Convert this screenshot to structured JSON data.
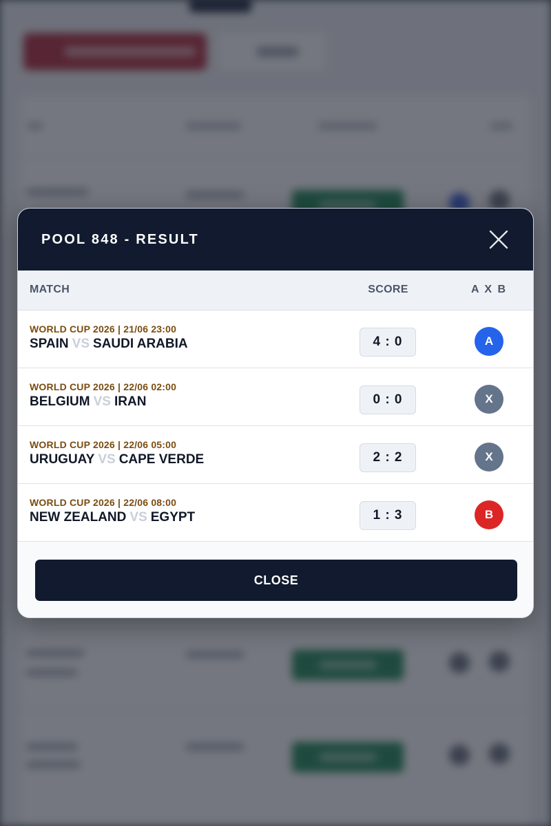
{
  "modal": {
    "title": "POOL 848 - RESULT",
    "close_button_label": "CLOSE",
    "columns": {
      "match": "MATCH",
      "score": "SCORE",
      "axb": "A X B"
    },
    "matches": [
      {
        "meta": "WORLD CUP 2026 | 21/06 23:00",
        "home": "SPAIN",
        "vs": "VS",
        "away": "SAUDI ARABIA",
        "score": "4 : 0",
        "result": "A"
      },
      {
        "meta": "WORLD CUP 2026 | 22/06 02:00",
        "home": "BELGIUM",
        "vs": "VS",
        "away": "IRAN",
        "score": "0 : 0",
        "result": "X"
      },
      {
        "meta": "WORLD CUP 2026 | 22/06 05:00",
        "home": "URUGUAY",
        "vs": "VS",
        "away": "CAPE VERDE",
        "score": "2 : 2",
        "result": "X"
      },
      {
        "meta": "WORLD CUP 2026 | 22/06 08:00",
        "home": "NEW ZEALAND",
        "vs": "VS",
        "away": "EGYPT",
        "score": "1 : 3",
        "result": "B"
      }
    ]
  },
  "colors": {
    "header_bg": "#111a2e",
    "result_a": "#2563eb",
    "result_x": "#64748b",
    "result_b": "#dc2626",
    "meta_text": "#7a4c10"
  }
}
